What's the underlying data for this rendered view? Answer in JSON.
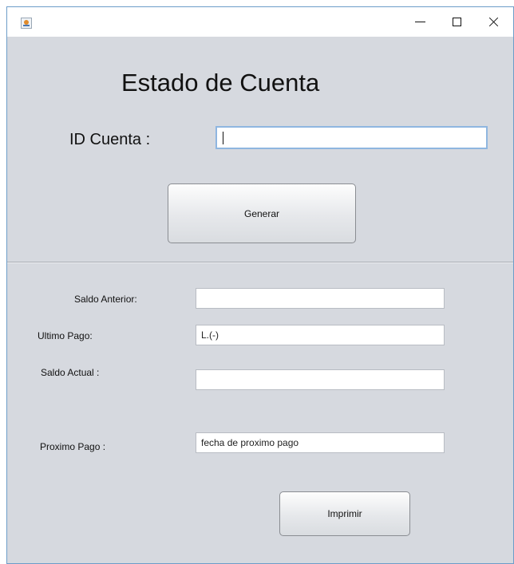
{
  "window": {
    "controls": {
      "minimize_icon": "minimize-icon",
      "maximize_icon": "maximize-icon",
      "close_icon": "close-icon"
    }
  },
  "header": {
    "title": "Estado de Cuenta"
  },
  "account": {
    "label": "ID Cuenta  :",
    "value": ""
  },
  "actions": {
    "generate_label": "Generar",
    "print_label": "Imprimir"
  },
  "fields": {
    "saldo_anterior": {
      "label": "Saldo Anterior:",
      "value": ""
    },
    "ultimo_pago": {
      "label": "Ultimo Pago:",
      "value": "L.(-)"
    },
    "saldo_actual": {
      "label": "Saldo Actual :",
      "value": ""
    },
    "proximo_pago": {
      "label": "Proximo Pago :",
      "value": "fecha de proximo pago"
    }
  },
  "colors": {
    "window_background": "#d6d9df",
    "focus_border": "#8fb6e0",
    "window_border": "#6d9dc9"
  }
}
